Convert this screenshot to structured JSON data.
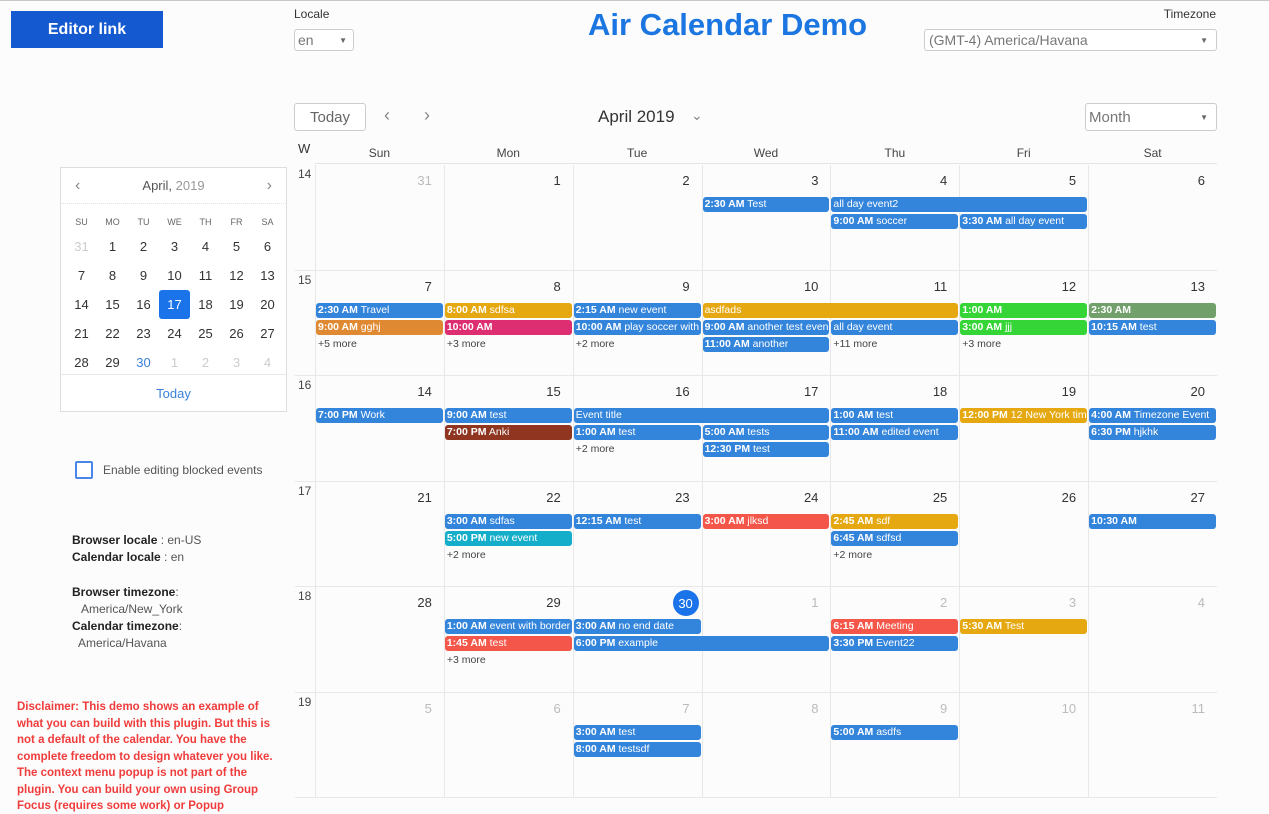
{
  "header": {
    "editor_link": "Editor link",
    "title": "Air Calendar Demo",
    "locale_label": "Locale",
    "locale_value": "en",
    "timezone_label": "Timezone",
    "timezone_value": "(GMT-4) America/Havana"
  },
  "mini_calendar": {
    "month": "April,",
    "year": "2019",
    "prev": "‹",
    "next": "›",
    "dow": [
      "SU",
      "MO",
      "TU",
      "WE",
      "TH",
      "FR",
      "SA"
    ],
    "days": [
      {
        "d": "31",
        "other": true
      },
      {
        "d": "1"
      },
      {
        "d": "2"
      },
      {
        "d": "3"
      },
      {
        "d": "4"
      },
      {
        "d": "5"
      },
      {
        "d": "6"
      },
      {
        "d": "7"
      },
      {
        "d": "8"
      },
      {
        "d": "9"
      },
      {
        "d": "10"
      },
      {
        "d": "11"
      },
      {
        "d": "12"
      },
      {
        "d": "13"
      },
      {
        "d": "14"
      },
      {
        "d": "15"
      },
      {
        "d": "16"
      },
      {
        "d": "17",
        "selected": true
      },
      {
        "d": "18"
      },
      {
        "d": "19"
      },
      {
        "d": "20"
      },
      {
        "d": "21"
      },
      {
        "d": "22"
      },
      {
        "d": "23"
      },
      {
        "d": "24"
      },
      {
        "d": "25"
      },
      {
        "d": "26"
      },
      {
        "d": "27"
      },
      {
        "d": "28"
      },
      {
        "d": "29"
      },
      {
        "d": "30",
        "today": true
      },
      {
        "d": "1",
        "other": true
      },
      {
        "d": "2",
        "other": true
      },
      {
        "d": "3",
        "other": true
      },
      {
        "d": "4",
        "other": true
      }
    ],
    "today_label": "Today"
  },
  "options": {
    "enable_blocked_label": "Enable editing blocked events",
    "enable_blocked_checked": false
  },
  "info": {
    "browser_locale_label": "Browser locale",
    "browser_locale_value": " : en-US",
    "calendar_locale_label": "Calendar locale",
    "calendar_locale_value": " : en",
    "browser_tz_label": "Browser timezone",
    "browser_tz_value": "America/New_York",
    "calendar_tz_label": "Calendar timezone",
    "calendar_tz_value": "America/Havana"
  },
  "disclaimer": "Disclaimer: This demo shows an example of what you can build with this plugin. But this is not a default of the calendar. You have the complete freedom to design whatever you like. The context menu popup is not part of the plugin. You can build your own using Group Focus (requires some work) or Popup",
  "toolbar": {
    "today": "Today",
    "prev": "‹",
    "next": "›",
    "period_title": "April 2019",
    "period_caret": "⌄",
    "view": "Month"
  },
  "calendar": {
    "week_header": "W",
    "dow": [
      "Sun",
      "Mon",
      "Tue",
      "Wed",
      "Thu",
      "Fri",
      "Sat"
    ],
    "colors": {
      "blue": "#3384db",
      "amber": "#e5a810",
      "orange": "#df8a32",
      "pink": "#dd2e72",
      "green": "#35d537",
      "sage": "#72a06b",
      "brown": "#8f3520",
      "red": "#f4574a",
      "teal": "#15aeca"
    },
    "weeks": [
      {
        "num": "14",
        "days": [
          {
            "d": "31",
            "other": true
          },
          {
            "d": "1"
          },
          {
            "d": "2"
          },
          {
            "d": "3"
          },
          {
            "d": "4"
          },
          {
            "d": "5"
          },
          {
            "d": "6"
          }
        ],
        "events": [
          {
            "start": 3,
            "span": 1,
            "row": 0,
            "time": "2:30 AM",
            "title": "Test",
            "color": "blue"
          },
          {
            "start": 4,
            "span": 2,
            "row": 0,
            "time": "",
            "title": "all day event2",
            "color": "blue"
          },
          {
            "start": 4,
            "span": 1,
            "row": 1,
            "time": "9:00 AM",
            "title": "soccer",
            "color": "blue"
          },
          {
            "start": 5,
            "span": 1,
            "row": 1,
            "time": "3:30 AM",
            "title": "all day event",
            "color": "blue"
          }
        ],
        "more": []
      },
      {
        "num": "15",
        "days": [
          {
            "d": "7"
          },
          {
            "d": "8"
          },
          {
            "d": "9"
          },
          {
            "d": "10"
          },
          {
            "d": "11"
          },
          {
            "d": "12"
          },
          {
            "d": "13"
          }
        ],
        "events": [
          {
            "start": 0,
            "span": 1,
            "row": 0,
            "time": "2:30 AM",
            "title": "Travel",
            "color": "blue"
          },
          {
            "start": 0,
            "span": 1,
            "row": 1,
            "time": "9:00 AM",
            "title": "gghj",
            "color": "orange"
          },
          {
            "start": 1,
            "span": 1,
            "row": 0,
            "time": "8:00 AM",
            "title": "sdfsa",
            "color": "amber"
          },
          {
            "start": 1,
            "span": 1,
            "row": 1,
            "time": "10:00 AM",
            "title": "",
            "color": "pink"
          },
          {
            "start": 2,
            "span": 1,
            "row": 0,
            "time": "2:15 AM",
            "title": "new event",
            "color": "blue"
          },
          {
            "start": 2,
            "span": 1,
            "row": 1,
            "time": "10:00 AM",
            "title": "play soccer with",
            "color": "blue"
          },
          {
            "start": 3,
            "span": 2,
            "row": 0,
            "time": "",
            "title": "asdfads",
            "color": "amber"
          },
          {
            "start": 3,
            "span": 1,
            "row": 1,
            "time": "9:00 AM",
            "title": "another test even",
            "color": "blue"
          },
          {
            "start": 3,
            "span": 1,
            "row": 2,
            "time": "11:00 AM",
            "title": "another",
            "color": "blue"
          },
          {
            "start": 4,
            "span": 1,
            "row": 1,
            "time": "",
            "title": "all day event",
            "color": "blue"
          },
          {
            "start": 5,
            "span": 1,
            "row": 0,
            "time": "1:00 AM",
            "title": "",
            "color": "green"
          },
          {
            "start": 5,
            "span": 1,
            "row": 1,
            "time": "3:00 AM",
            "title": "jjj",
            "color": "green"
          },
          {
            "start": 6,
            "span": 1,
            "row": 0,
            "time": "2:30 AM",
            "title": "",
            "color": "sage"
          },
          {
            "start": 6,
            "span": 1,
            "row": 1,
            "time": "10:15 AM",
            "title": "test",
            "color": "blue"
          }
        ],
        "more": [
          {
            "day": 0,
            "row": 2,
            "label": "+5 more"
          },
          {
            "day": 1,
            "row": 2,
            "label": "+3 more"
          },
          {
            "day": 2,
            "row": 2,
            "label": "+2 more"
          },
          {
            "day": 4,
            "row": 2,
            "label": "+11 more"
          },
          {
            "day": 5,
            "row": 2,
            "label": "+3 more"
          }
        ]
      },
      {
        "num": "16",
        "days": [
          {
            "d": "14"
          },
          {
            "d": "15"
          },
          {
            "d": "16"
          },
          {
            "d": "17"
          },
          {
            "d": "18"
          },
          {
            "d": "19"
          },
          {
            "d": "20"
          }
        ],
        "events": [
          {
            "start": 0,
            "span": 1,
            "row": 0,
            "time": "7:00 PM",
            "title": "Work",
            "color": "blue"
          },
          {
            "start": 1,
            "span": 1,
            "row": 0,
            "time": "9:00 AM",
            "title": "test",
            "color": "blue"
          },
          {
            "start": 1,
            "span": 1,
            "row": 1,
            "time": "7:00 PM",
            "title": "Anki",
            "color": "brown"
          },
          {
            "start": 2,
            "span": 2,
            "row": 0,
            "time": "",
            "title": "Event title",
            "color": "blue"
          },
          {
            "start": 2,
            "span": 1,
            "row": 1,
            "time": "1:00 AM",
            "title": "test",
            "color": "blue"
          },
          {
            "start": 3,
            "span": 1,
            "row": 1,
            "time": "5:00 AM",
            "title": "tests",
            "color": "blue"
          },
          {
            "start": 3,
            "span": 1,
            "row": 2,
            "time": "12:30 PM",
            "title": "test",
            "color": "blue"
          },
          {
            "start": 4,
            "span": 1,
            "row": 0,
            "time": "1:00 AM",
            "title": "test",
            "color": "blue"
          },
          {
            "start": 4,
            "span": 1,
            "row": 1,
            "time": "11:00 AM",
            "title": "edited event",
            "color": "blue"
          },
          {
            "start": 5,
            "span": 1,
            "row": 0,
            "time": "12:00 PM",
            "title": "12 New York tim",
            "color": "amber"
          },
          {
            "start": 6,
            "span": 1,
            "row": 0,
            "time": "4:00 AM",
            "title": "Timezone Event",
            "color": "blue"
          },
          {
            "start": 6,
            "span": 1,
            "row": 1,
            "time": "6:30 PM",
            "title": "hjkhk",
            "color": "blue"
          }
        ],
        "more": [
          {
            "day": 2,
            "row": 2,
            "label": "+2 more"
          }
        ]
      },
      {
        "num": "17",
        "days": [
          {
            "d": "21"
          },
          {
            "d": "22"
          },
          {
            "d": "23"
          },
          {
            "d": "24"
          },
          {
            "d": "25"
          },
          {
            "d": "26"
          },
          {
            "d": "27"
          }
        ],
        "events": [
          {
            "start": 1,
            "span": 1,
            "row": 0,
            "time": "3:00 AM",
            "title": "sdfas",
            "color": "blue"
          },
          {
            "start": 1,
            "span": 1,
            "row": 1,
            "time": "5:00 PM",
            "title": "new event",
            "color": "teal"
          },
          {
            "start": 2,
            "span": 1,
            "row": 0,
            "time": "12:15 AM",
            "title": "test",
            "color": "blue"
          },
          {
            "start": 3,
            "span": 1,
            "row": 0,
            "time": "3:00 AM",
            "title": "jlksd",
            "color": "red"
          },
          {
            "start": 4,
            "span": 1,
            "row": 0,
            "time": "2:45 AM",
            "title": "sdf",
            "color": "amber"
          },
          {
            "start": 4,
            "span": 1,
            "row": 1,
            "time": "6:45 AM",
            "title": "sdfsd",
            "color": "blue"
          },
          {
            "start": 6,
            "span": 1,
            "row": 0,
            "time": "10:30 AM",
            "title": "",
            "color": "blue"
          }
        ],
        "more": [
          {
            "day": 1,
            "row": 2,
            "label": "+2 more"
          },
          {
            "day": 4,
            "row": 2,
            "label": "+2 more"
          }
        ]
      },
      {
        "num": "18",
        "days": [
          {
            "d": "28"
          },
          {
            "d": "29"
          },
          {
            "d": "30",
            "today": true
          },
          {
            "d": "1",
            "other": true
          },
          {
            "d": "2",
            "other": true
          },
          {
            "d": "3",
            "other": true
          },
          {
            "d": "4",
            "other": true
          }
        ],
        "events": [
          {
            "start": 1,
            "span": 1,
            "row": 0,
            "time": "1:00 AM",
            "title": "event with border",
            "color": "blue"
          },
          {
            "start": 1,
            "span": 1,
            "row": 1,
            "time": "1:45 AM",
            "title": "test",
            "color": "red"
          },
          {
            "start": 2,
            "span": 1,
            "row": 0,
            "time": "3:00 AM",
            "title": "no end date",
            "color": "blue"
          },
          {
            "start": 2,
            "span": 2,
            "row": 1,
            "time": "6:00 PM",
            "title": "example",
            "color": "blue"
          },
          {
            "start": 4,
            "span": 1,
            "row": 0,
            "time": "6:15 AM",
            "title": "Meeting",
            "color": "red"
          },
          {
            "start": 4,
            "span": 1,
            "row": 1,
            "time": "3:30 PM",
            "title": "Event22",
            "color": "blue"
          },
          {
            "start": 5,
            "span": 1,
            "row": 0,
            "time": "5:30 AM",
            "title": "Test",
            "color": "amber"
          }
        ],
        "more": [
          {
            "day": 1,
            "row": 2,
            "label": "+3 more"
          }
        ]
      },
      {
        "num": "19",
        "days": [
          {
            "d": "5",
            "other": true
          },
          {
            "d": "6",
            "other": true
          },
          {
            "d": "7",
            "other": true
          },
          {
            "d": "8",
            "other": true
          },
          {
            "d": "9",
            "other": true
          },
          {
            "d": "10",
            "other": true
          },
          {
            "d": "11",
            "other": true
          }
        ],
        "events": [
          {
            "start": 2,
            "span": 1,
            "row": 0,
            "time": "3:00 AM",
            "title": "test",
            "color": "blue"
          },
          {
            "start": 2,
            "span": 1,
            "row": 1,
            "time": "8:00 AM",
            "title": "testsdf",
            "color": "blue"
          },
          {
            "start": 4,
            "span": 1,
            "row": 0,
            "time": "5:00 AM",
            "title": "asdfs",
            "color": "blue"
          }
        ],
        "more": []
      }
    ]
  }
}
